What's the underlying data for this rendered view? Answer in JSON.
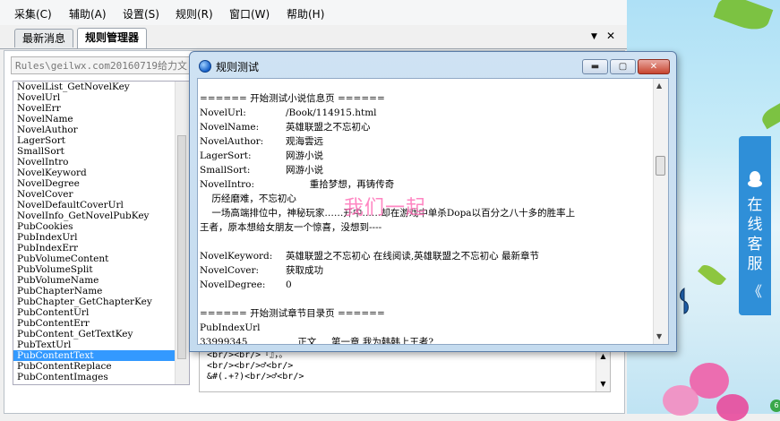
{
  "menubar": {
    "items": [
      "采集(C)",
      "辅助(A)",
      "设置(S)",
      "规则(R)",
      "窗口(W)",
      "帮助(H)"
    ]
  },
  "tabs": {
    "items": [
      {
        "label": "最新消息",
        "active": false
      },
      {
        "label": "规则管理器",
        "active": true
      }
    ],
    "dropdown_glyph": "▼",
    "close_glyph": "✕"
  },
  "rule_selector": {
    "value": "Rules\\geilwx.com20160719给力文"
  },
  "field_list": {
    "items": [
      "NovelList_GetNovelKey",
      "NovelUrl",
      "NovelErr",
      "NovelName",
      "NovelAuthor",
      "LagerSort",
      "SmallSort",
      "NovelIntro",
      "NovelKeyword",
      "NovelDegree",
      "NovelCover",
      "NovelDefaultCoverUrl",
      "NovelInfo_GetNovelPubKey",
      "PubCookies",
      "PubIndexUrl",
      "PubIndexErr",
      "PubVolumeContent",
      "PubVolumeSplit",
      "PubVolumeName",
      "PubChapterName",
      "PubChapter_GetChapterKey",
      "PubContentUrl",
      "PubContentErr",
      "PubContent_GetTextKey",
      "PubTextUrl",
      "PubContentText",
      "PubContentReplace",
      "PubContentImages"
    ],
    "selected": "PubContentText"
  },
  "replace_box": {
    "lines": [
      "<br/><br/>『』，。",
      "<br/><br/>♂<br/>",
      "&#(.+?)<br/>♂<br/>"
    ]
  },
  "dialog": {
    "title": "规则测试",
    "minimize_glyph": "▬",
    "maximize_glyph": "▢",
    "close_glyph": "✕",
    "lines": [
      {
        "label": "",
        "value": ""
      },
      {
        "label": "",
        "value": "====== 开始测试小说信息页 ======"
      },
      {
        "label": "NovelUrl:",
        "value": "/Book/114915.html"
      },
      {
        "label": "NovelName:",
        "value": "英雄联盟之不忘初心"
      },
      {
        "label": "NovelAuthor:",
        "value": "观海雲远"
      },
      {
        "label": "LagerSort:",
        "value": "网游小说"
      },
      {
        "label": "SmallSort:",
        "value": "网游小说"
      },
      {
        "label": "NovelIntro:",
        "value": "        重拾梦想，再铸传奇"
      },
      {
        "label": "",
        "value": "    历经磨难，不忘初心"
      },
      {
        "label": "",
        "value": "    一场高端排位中，神秘玩家……开中……却在游戏中单杀Dopa以百分之八十多的胜率上"
      },
      {
        "label": "",
        "value": "王者，原本想给女朋友一个惊喜，没想到----"
      },
      {
        "label": "",
        "value": ""
      },
      {
        "label": "NovelKeyword:",
        "value": "英雄联盟之不忘初心 在线阅读,英雄联盟之不忘初心 最新章节"
      },
      {
        "label": "NovelCover:",
        "value": "获取成功"
      },
      {
        "label": "NovelDegree:",
        "value": "0"
      },
      {
        "label": "",
        "value": ""
      },
      {
        "label": "",
        "value": "====== 开始测试章节目录页 ======"
      },
      {
        "label": "",
        "value": "PubIndexUrl"
      },
      {
        "label": "33999345",
        "value": "    正文     第一章 我为韩韩上王者?"
      }
    ]
  },
  "watermark": {
    "text": "我们一起"
  },
  "service_panel": {
    "text": "在线客服",
    "collapse_glyph": "《"
  },
  "colors": {
    "accent": "#3399ff",
    "service_panel": "#2f8fd8"
  }
}
